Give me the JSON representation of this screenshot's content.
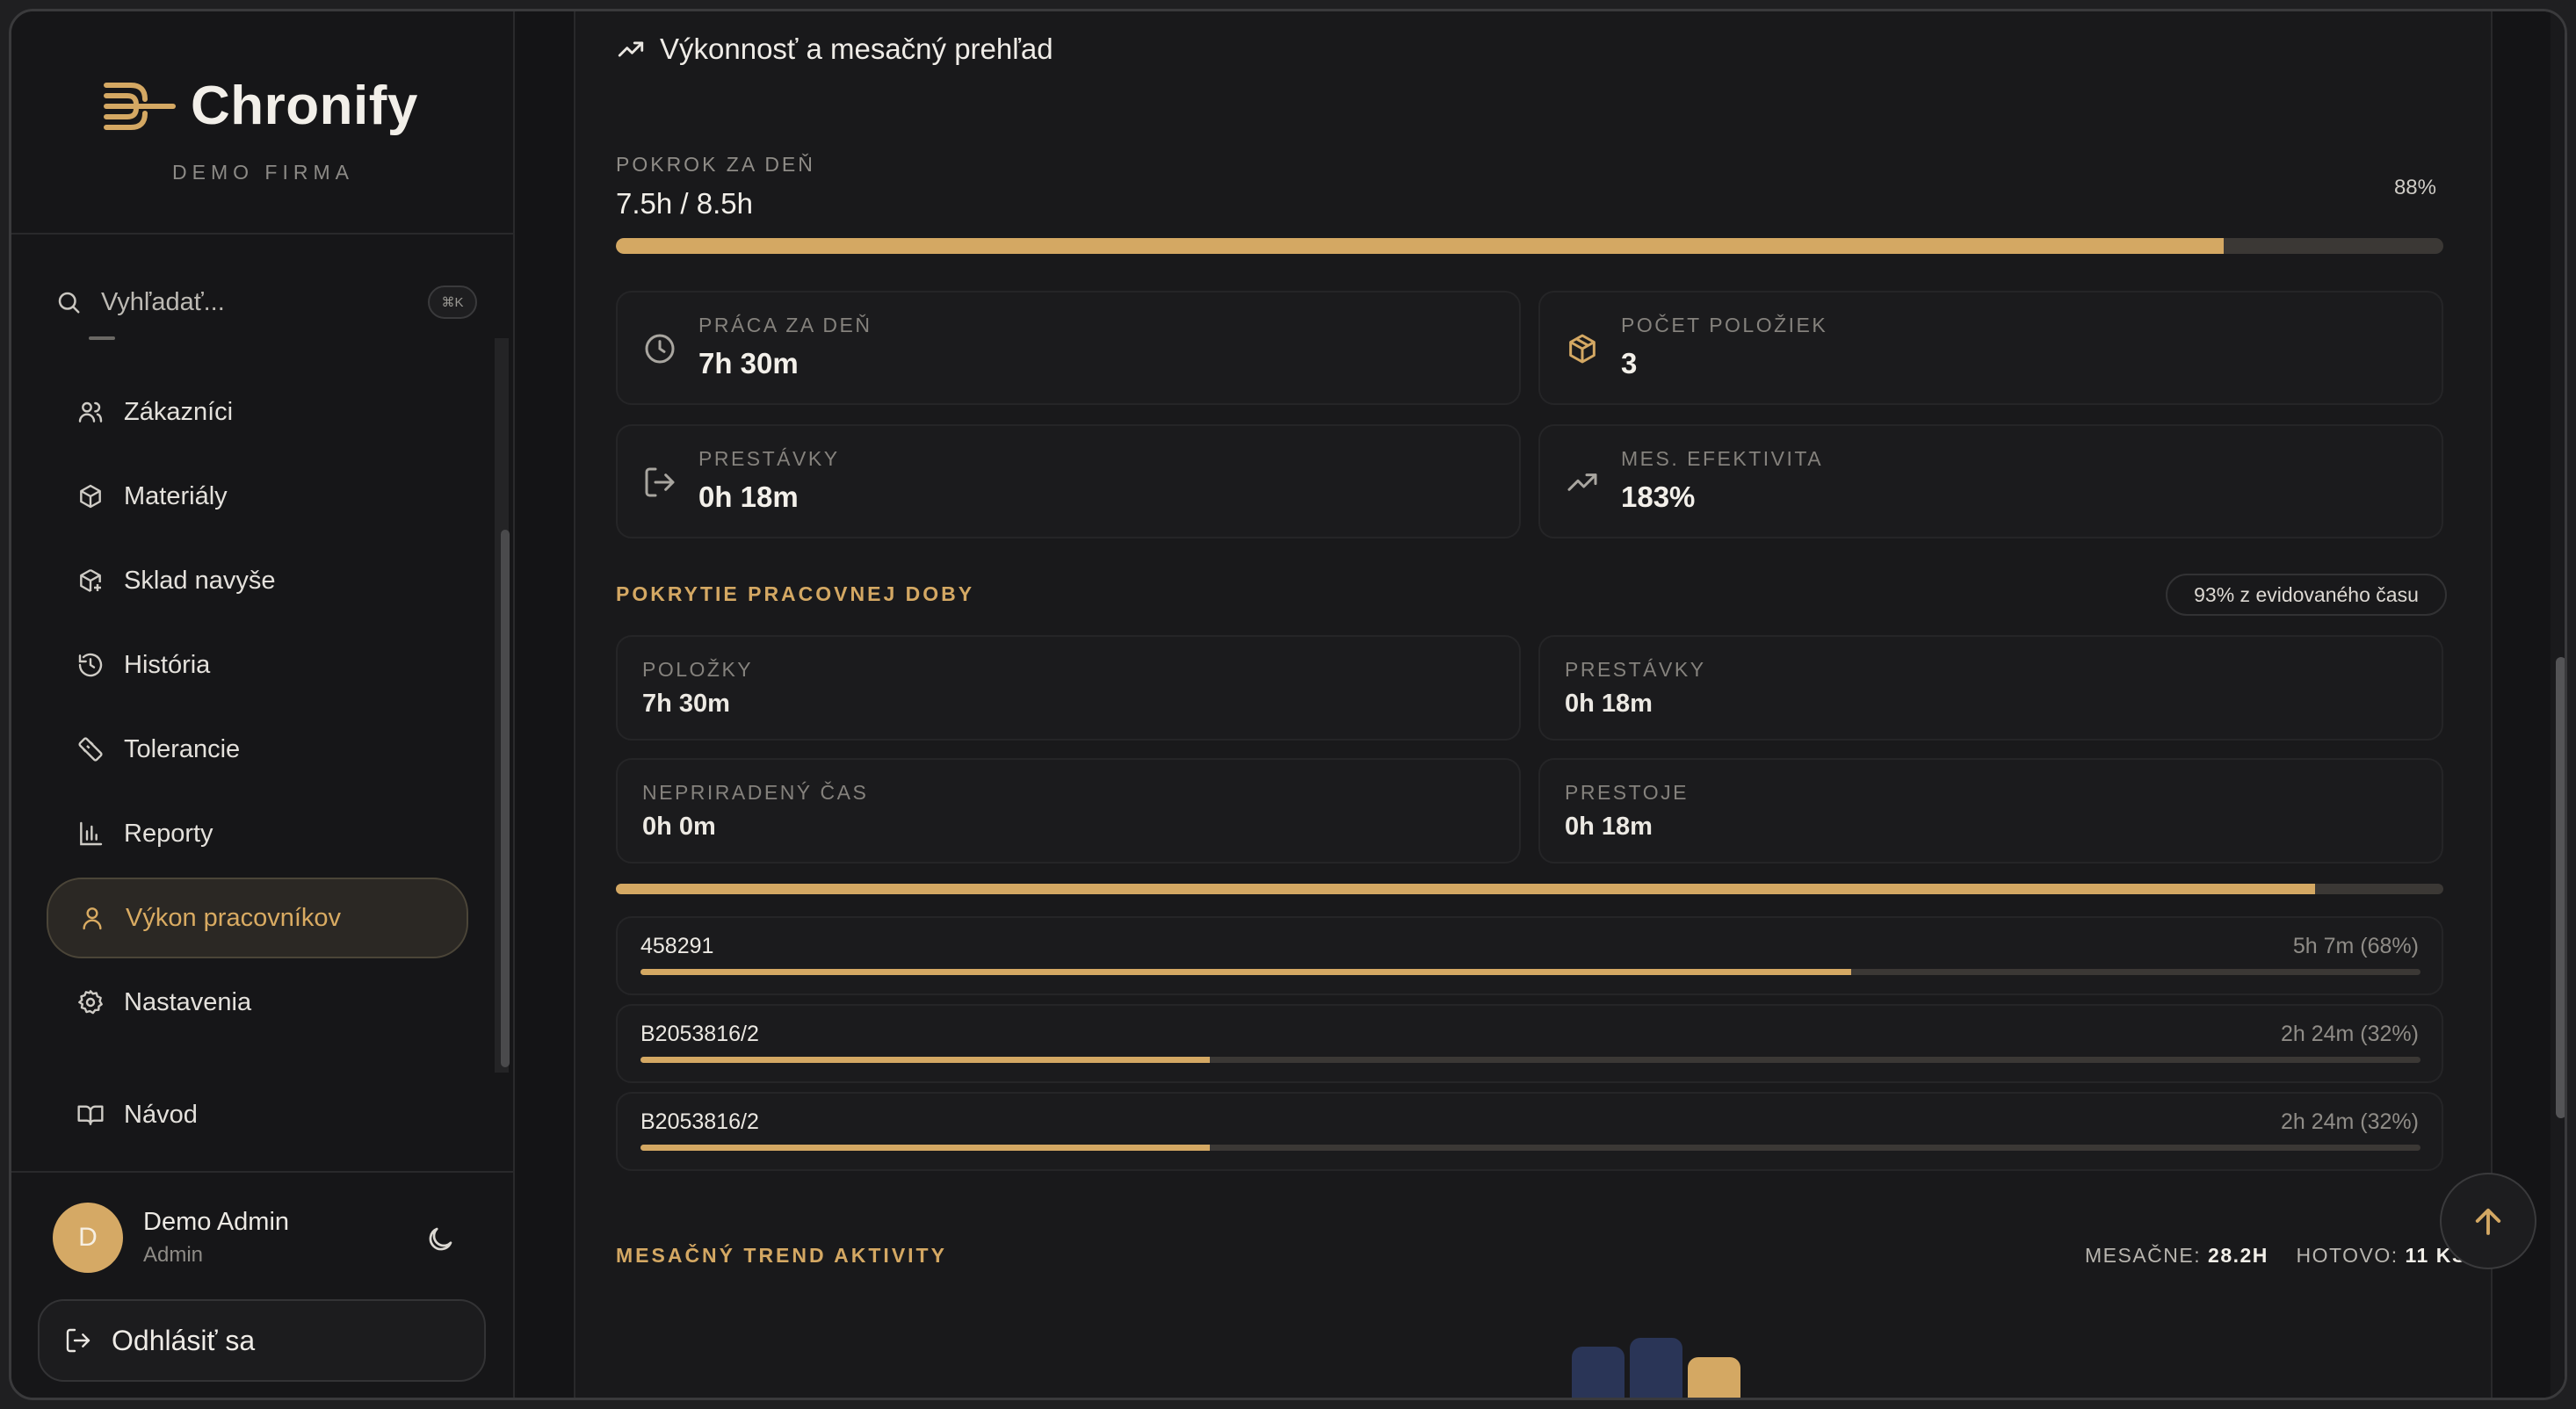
{
  "app": {
    "name": "Chronify",
    "company": "DEMO FIRMA"
  },
  "search": {
    "placeholder": "Vyhľadať...",
    "shortcut": "⌘K"
  },
  "sidebar": {
    "items": [
      {
        "label": "Zákazníci",
        "icon": "users-icon"
      },
      {
        "label": "Materiály",
        "icon": "package-icon"
      },
      {
        "label": "Sklad navyše",
        "icon": "package-plus-icon"
      },
      {
        "label": "História",
        "icon": "history-icon"
      },
      {
        "label": "Tolerancie",
        "icon": "ruler-icon"
      },
      {
        "label": "Reporty",
        "icon": "bar-chart-icon"
      },
      {
        "label": "Výkon pracovníkov",
        "icon": "user-icon",
        "active": true
      },
      {
        "label": "Nastavenia",
        "icon": "gear-icon"
      },
      {
        "label": "Návod",
        "icon": "book-icon"
      }
    ]
  },
  "user": {
    "initial": "D",
    "name": "Demo Admin",
    "role": "Admin",
    "logout_label": "Odhlásiť sa"
  },
  "main": {
    "section_title": "Výkonnosť a mesačný prehľad",
    "day_progress": {
      "label": "POKROK ZA DEŇ",
      "value": "7.5h / 8.5h",
      "percent_label": "88%",
      "percent": 88
    },
    "stats": [
      {
        "label": "PRÁCA ZA DEŇ",
        "value": "7h 30m",
        "icon": "clock-icon"
      },
      {
        "label": "POČET POLOŽIEK",
        "value": "3",
        "icon": "package-icon"
      },
      {
        "label": "PRESTÁVKY",
        "value": "0h 18m",
        "icon": "logout-icon"
      },
      {
        "label": "MES. EFEKTIVITA",
        "value": "183%",
        "icon": "trending-up-icon"
      }
    ],
    "coverage": {
      "title": "POKRYTIE PRACOVNEJ DOBY",
      "badge": "93% z evidovaného času",
      "percent": 93,
      "cells": [
        {
          "label": "POLOŽKY",
          "value": "7h 30m"
        },
        {
          "label": "PRESTÁVKY",
          "value": "0h 18m"
        },
        {
          "label": "NEPRIRADENÝ ČAS",
          "value": "0h 0m"
        },
        {
          "label": "PRESTOJE",
          "value": "0h 18m"
        }
      ]
    },
    "items": [
      {
        "name": "458291",
        "time": "5h 7m (68%)",
        "percent": 68
      },
      {
        "name": "B2053816/2",
        "time": "2h 24m (32%)",
        "percent": 32
      },
      {
        "name": "B2053816/2",
        "time": "2h 24m (32%)",
        "percent": 32
      }
    ],
    "trend": {
      "title": "MESAČNÝ TREND AKTIVITY",
      "monthly_label": "MESAČNE:",
      "monthly_value": "28.2H",
      "done_label": "HOTOVO:",
      "done_value": "11 KS"
    }
  },
  "colors": {
    "accent": "#d4a863",
    "navy": "#2a3557",
    "background": "#19191b"
  }
}
